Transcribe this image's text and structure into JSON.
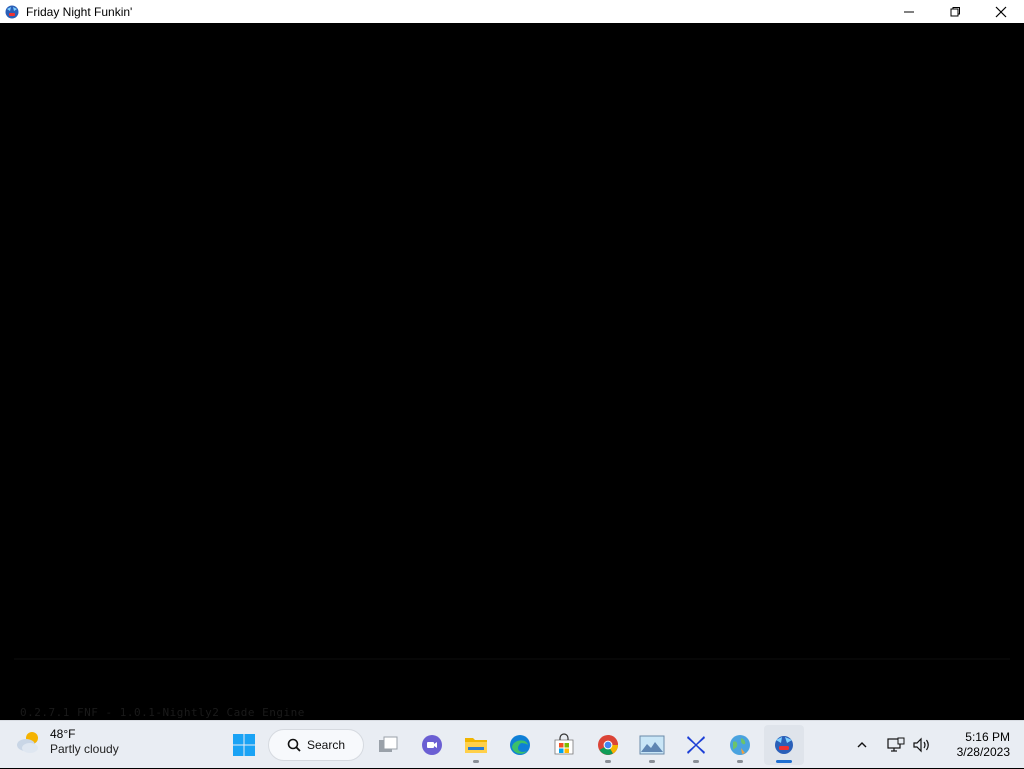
{
  "window": {
    "title": "Friday Night Funkin'",
    "controls": [
      "minimize-icon",
      "restore-icon",
      "close-icon"
    ]
  },
  "game": {
    "version_text": "0.2.7.1 FNF - 1.0.1-Nightly2 Cade Engine"
  },
  "taskbar": {
    "weather": {
      "temp": "48°F",
      "desc": "Partly cloudy",
      "icon": "partly-cloudy-icon"
    },
    "search_label": "Search",
    "apps": [
      {
        "name": "start",
        "icon": "windows-start-icon"
      },
      {
        "name": "search",
        "icon": "search-icon"
      },
      {
        "name": "task-view",
        "icon": "task-view-icon"
      },
      {
        "name": "teams-chat",
        "icon": "teams-chat-icon"
      },
      {
        "name": "file-explorer",
        "icon": "folder-icon"
      },
      {
        "name": "edge",
        "icon": "edge-icon"
      },
      {
        "name": "microsoft-store",
        "icon": "store-icon"
      },
      {
        "name": "chrome",
        "icon": "chrome-icon"
      },
      {
        "name": "photos-app",
        "icon": "image-icon"
      },
      {
        "name": "x-app",
        "icon": "x-logo-icon"
      },
      {
        "name": "maps-app",
        "icon": "globe-icon"
      },
      {
        "name": "friday-night-funkin",
        "icon": "fnf-icon"
      }
    ],
    "clock": {
      "time": "5:16 PM",
      "date": "3/28/2023"
    },
    "colors": {
      "taskbar_bg": "#e9edf3",
      "accent": "#1f6fd1"
    }
  }
}
